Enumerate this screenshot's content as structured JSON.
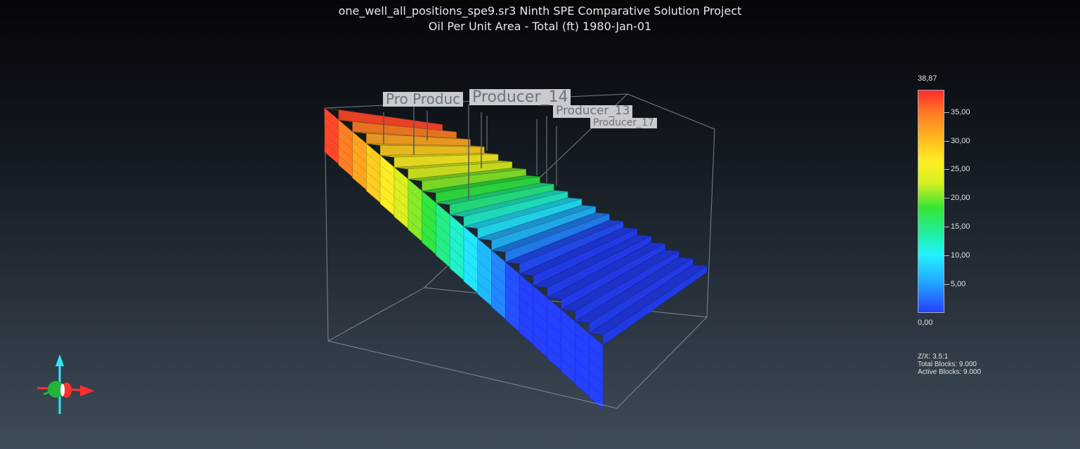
{
  "title": {
    "line1": "one_well_all_positions_spe9.sr3 Ninth SPE Comparative Solution Project",
    "line2": "Oil Per Unit Area - Total (ft)  1980-Jan-01"
  },
  "legend": {
    "max_label": "38,87",
    "min_label": "0,00",
    "ticks": [
      {
        "value": 35,
        "label": "35,00"
      },
      {
        "value": 30,
        "label": "30,00"
      },
      {
        "value": 25,
        "label": "25,00"
      },
      {
        "value": 20,
        "label": "20,00"
      },
      {
        "value": 15,
        "label": "15,00"
      },
      {
        "value": 10,
        "label": "10,00"
      },
      {
        "value": 5,
        "label": "5,00"
      }
    ],
    "min": 0,
    "max": 38.87
  },
  "info": {
    "zx": "Z/X: 3.5:1",
    "total_blocks": "Total Blocks: 9.000",
    "active_blocks": "Active Blocks: 9.000"
  },
  "wells": [
    {
      "label": "Pro Produc"
    },
    {
      "label": "Producer_14"
    },
    {
      "label": "Producer_13"
    },
    {
      "label": "Producer_17"
    }
  ],
  "colors": {
    "low": "#2540ff",
    "mid": "#33e633",
    "high": "#ff2b2b"
  }
}
